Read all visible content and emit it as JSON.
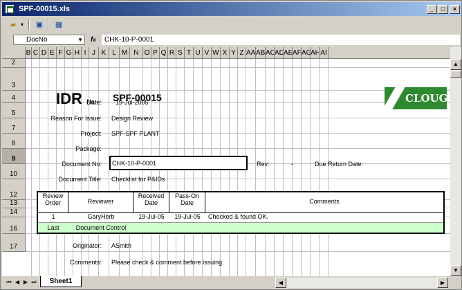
{
  "window": {
    "title": "SPF-00015.xls"
  },
  "toolbar": {
    "items": [
      {
        "icon": "open-folder-icon"
      },
      {
        "icon": "dropdown-icon"
      },
      {
        "icon": "window-icon"
      },
      {
        "icon": "grid-icon"
      }
    ]
  },
  "formula_bar": {
    "name_box": "DocNo",
    "fx": "fx",
    "formula": "CHK-10-P-0001"
  },
  "columns": [
    "B",
    "C",
    "D",
    "E",
    "F",
    "G",
    "H",
    "I",
    "J",
    "K",
    "L",
    "M",
    "N",
    "O",
    "P",
    "Q",
    "R",
    "S",
    "T",
    "U",
    "V",
    "W",
    "X",
    "Y",
    "Z",
    "AA",
    "AB",
    "AC",
    "AD",
    "AE",
    "AF",
    "AG",
    "AH",
    "AI"
  ],
  "rows": [
    "2",
    "3",
    "4",
    "5",
    "7",
    "8",
    "9",
    "10",
    "12",
    "13",
    "14",
    "16",
    "17"
  ],
  "sheet": {
    "logo": "IDR",
    "no_label": "No:",
    "doc_number": "SPF-00015",
    "company_logo": "CLOUGH",
    "date_label": "Date:",
    "date_value": "19-Jul-2005",
    "reason_label": "Reason For Issue:",
    "reason_value": "Design Review",
    "project_label": "Project:",
    "project_value": "SPF-SPF PLANT",
    "package_label": "Package:",
    "package_value": "",
    "docno_label": "Document No:",
    "docno_value": "CHK-10-P-0001",
    "rev_label": "Rev:",
    "rev_value": "-",
    "due_label": "Due Return Date:",
    "due_value": "",
    "title_label": "Document Title:",
    "title_value": "Checklist for P&IDs",
    "table_headers": {
      "review_order": "Review Order",
      "reviewer": "Reviewer",
      "received_date": "Received Date",
      "pass_on_date": "Pass-On Date",
      "comments": "Comments"
    },
    "review_rows": [
      {
        "order": "1",
        "reviewer": "GaryHerb",
        "received": "19-Jul-05",
        "pass_on": "19-Jul-05",
        "comments": "Checked & found OK."
      },
      {
        "order": "Last",
        "reviewer": "Document Control",
        "received": "",
        "pass_on": "",
        "comments": ""
      }
    ],
    "originator_label": "Originator:",
    "originator_value": "ASmith",
    "comments_label": "Comments:",
    "comments_value": "Please check & comment before issuing."
  },
  "sheet_tabs": [
    "Sheet1"
  ],
  "colors": {
    "title_bar": "#0a246a",
    "last_row": "#ccffcc",
    "clough_green": "#2f8a2f"
  }
}
